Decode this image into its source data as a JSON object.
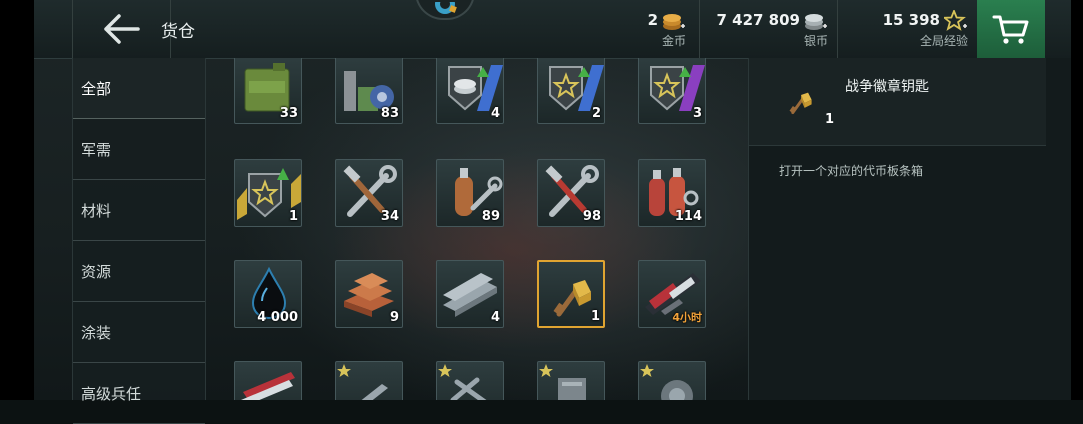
{
  "header": {
    "title": "货仓",
    "back_icon": "back-arrow-icon",
    "logo_icon": "gear-emblem-icon"
  },
  "currencies": [
    {
      "value": "2",
      "label": "金币",
      "icon": "gold-coin-icon",
      "color": "#e3a73a"
    },
    {
      "value": "7 427 809",
      "label": "银币",
      "icon": "silver-coin-icon",
      "color": "#c9d0d2"
    },
    {
      "value": "15 398",
      "label": "全局经验",
      "icon": "star-exp-icon",
      "color": "#d8c45a"
    }
  ],
  "cart_icon": "shopping-cart-icon",
  "accent_color": "#e0a431",
  "sidebar": {
    "items": [
      {
        "label": "全部",
        "active": true
      },
      {
        "label": "军需",
        "active": false
      },
      {
        "label": "材料",
        "active": false
      },
      {
        "label": "资源",
        "active": false
      },
      {
        "label": "涂装",
        "active": false
      },
      {
        "label": "高级兵任",
        "active": false
      }
    ]
  },
  "inventory": {
    "rows": [
      [
        {
          "icon": "air-supply-canister-icon",
          "count": "33"
        },
        {
          "icon": "equipment-crate-icon",
          "count": "83"
        },
        {
          "icon": "silver-coin-rank-badge-icon",
          "count": "4"
        },
        {
          "icon": "star-rank-badge-blue-icon",
          "count": "2"
        },
        {
          "icon": "star-rank-badge-purple-icon",
          "count": "3"
        }
      ],
      [
        {
          "icon": "star-rank-badge-gold-icon",
          "count": "1"
        },
        {
          "icon": "wrench-hammer-icon",
          "count": "34"
        },
        {
          "icon": "gas-cylinder-wrench-icon",
          "count": "89"
        },
        {
          "icon": "wrench-hammer-red-icon",
          "count": "98"
        },
        {
          "icon": "gas-cylinders-red-icon",
          "count": "114"
        }
      ],
      [
        {
          "icon": "oil-drop-icon",
          "count": "4 000"
        },
        {
          "icon": "copper-ingots-icon",
          "count": "9"
        },
        {
          "icon": "steel-beams-icon",
          "count": "4"
        },
        {
          "icon": "war-badge-key-icon",
          "count": "1",
          "selected": true
        },
        {
          "icon": "camouflage-swatch-icon",
          "count": "4小时",
          "timer": true
        }
      ],
      [
        {
          "icon": "camouflage-pattern-icon",
          "count": ""
        },
        {
          "icon": "torpedo-star-icon",
          "count": ""
        },
        {
          "icon": "aircraft-star-icon",
          "count": ""
        },
        {
          "icon": "turret-star-icon",
          "count": ""
        },
        {
          "icon": "radar-star-icon",
          "count": ""
        }
      ]
    ]
  },
  "detail": {
    "icon": "war-badge-key-icon",
    "name": "战争徽章钥匙",
    "count": "1",
    "description": "打开一个对应的代币板条箱"
  }
}
